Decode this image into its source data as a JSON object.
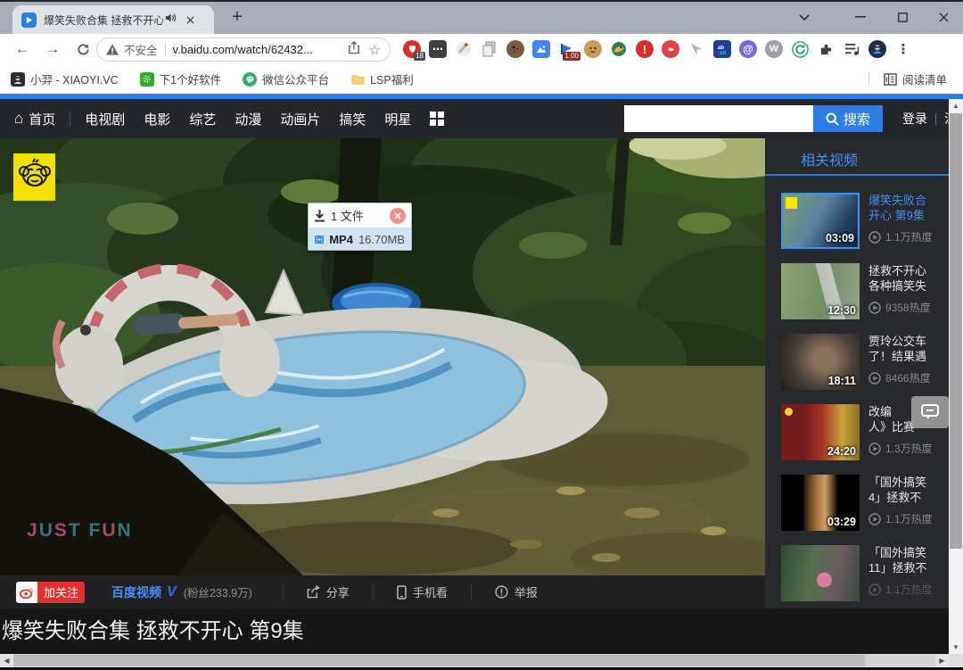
{
  "browser": {
    "tab": {
      "title": "爆笑失败合集 拯救不开心 第"
    },
    "address": {
      "security": "不安全",
      "url": "v.baidu.com/watch/62432..."
    },
    "extensions": {
      "adguard_badge": "18",
      "flag_badge": "1.00"
    },
    "bookmarks": [
      {
        "label": "小羿 - XIAOYI.VC"
      },
      {
        "label": "下1个好软件"
      },
      {
        "label": "微信公众平台"
      },
      {
        "label": "LSP福利"
      }
    ],
    "reading_list": "阅读清单"
  },
  "site_nav": {
    "home": "首页",
    "links": [
      "电视剧",
      "电影",
      "综艺",
      "动漫",
      "动画片",
      "搞笑",
      "明星"
    ],
    "search_button": "搜索",
    "login": "登录",
    "register": "注册"
  },
  "player": {
    "watermark": "JUST FUN",
    "download_popup": {
      "files": "1 文件",
      "format": "MP4",
      "size": "16.70MB"
    }
  },
  "related": {
    "header": "相关视频",
    "items": [
      {
        "title1": "爆笑失败合",
        "title2": "开心 第9集",
        "duration": "03:09",
        "heat": "1.1万热度"
      },
      {
        "title1": "拯救不开心",
        "title2": "各种搞笑失",
        "duration": "12:30",
        "heat": "9358热度"
      },
      {
        "title1": "贾玲公交车",
        "title2": "了！结果遇",
        "duration": "18:11",
        "heat": "8466热度"
      },
      {
        "title1": "改编",
        "title2": "人》比赛",
        "duration": "24:20",
        "heat": "1.3万热度"
      },
      {
        "title1": "「国外搞笑",
        "title2": "4」拯救不",
        "duration": "03:29",
        "heat": "1.1万热度"
      },
      {
        "title1": "「国外搞笑",
        "title2": "11」拯救不",
        "duration": "",
        "heat": "1.1万热度"
      }
    ]
  },
  "action_bar": {
    "follow": "加关注",
    "channel": "百度视频",
    "v_badge": "V",
    "fans": "(粉丝233.9万)",
    "share": "分享",
    "mobile": "手机看",
    "report": "举报"
  },
  "video_title": "爆笑失败合集 拯救不开心 第9集",
  "icons": {
    "plus": "+",
    "star": "☆",
    "back": "←",
    "forward": "→",
    "home": "⌂",
    "kebab": "⋮",
    "more_dots": "⋯",
    "up": "▲",
    "down": "▼",
    "left": "◀",
    "right": "▶",
    "at": "@",
    "w": "W",
    "alert": "!"
  },
  "colors": {
    "accent_blue": "#2b7bea",
    "link_blue": "#3f8ff5",
    "follow_red": "#e0312e"
  }
}
